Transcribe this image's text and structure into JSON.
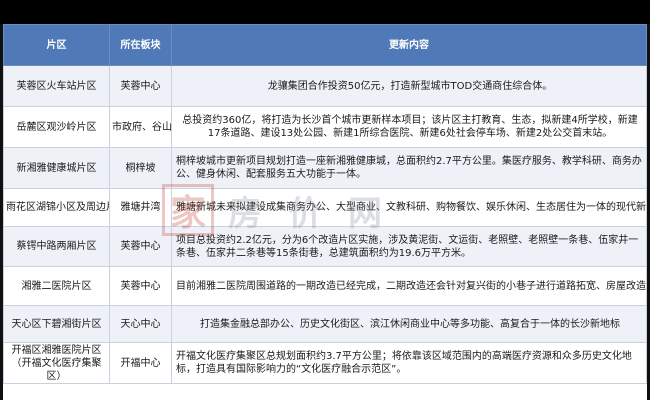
{
  "headers": [
    "片区",
    "所在板块",
    "更新内容"
  ],
  "rows": [
    {
      "area": "芙蓉区火车站片区",
      "board": "芙蓉中心",
      "content": "龙骧集团合作投资50亿元，打造新型城市TOD交通商住综合体。"
    },
    {
      "area": "岳麓区观沙岭片区",
      "board": "市政府、谷山",
      "content": "总投资约360亿，将打造为长沙首个城市更新样本项目；该片区主打教育、生态，拟新建4所学校，新建17条道路、建设13处公园、新建1所综合医院、新建6处社会停车场、新建2处公交首末站。"
    },
    {
      "area": "新湘雅健康城片区",
      "board": "桐梓坡",
      "content": "桐梓坡城市更新项目规划打造一座新湘雅健康城，总面积约2.7平方公里。集医疗服务、教学科研、商务办公、健身休闲、配套服务五大功能于一体。"
    },
    {
      "area": "雨花区湖锦小区及周边片区",
      "board": "雅塘井湾",
      "content": "雅塘新城未来拟建设成集商务办公、大型商业、文教科研、购物餐饮、娱乐休闲、生态居住为一体的现代新城"
    },
    {
      "area": "蔡锷中路两厢片区",
      "board": "芙蓉中心",
      "content": "项目总投资约2.2亿元，分为6个改造片区实施，涉及黄泥街、文运街、老照壁、老照壁一条巷、伍家井一条巷、伍家井二条巷等15条街巷，总建筑面积约为19.6万平方米。"
    },
    {
      "area": "湘雅二医院片区",
      "board": "芙蓉中心",
      "content": "目前湘雅二医院周围道路的一期改造已经完成，二期改造还会针对复兴街的小巷子进行道路拓宽、房屋改造."
    },
    {
      "area": "天心区下碧湘街片区",
      "board": "天心中心",
      "content": "打造集金融总部办公、历史文化街区、滨江休闲商业中心等多功能、高复合于一体的长沙新地标"
    },
    {
      "area": "开福区湘雅医院片区（开福文化医疗集聚区）",
      "board": "开福中心",
      "content": "开福文化医疗集聚区总规划面积约3.7平方公里；将依靠该区域范围内的高端医疗资源和众多历史文化地标，打造具有国际影响力的“文化医疗融合示范区”。"
    }
  ],
  "watermark": {
    "seal": "家",
    "text": "房价网"
  }
}
